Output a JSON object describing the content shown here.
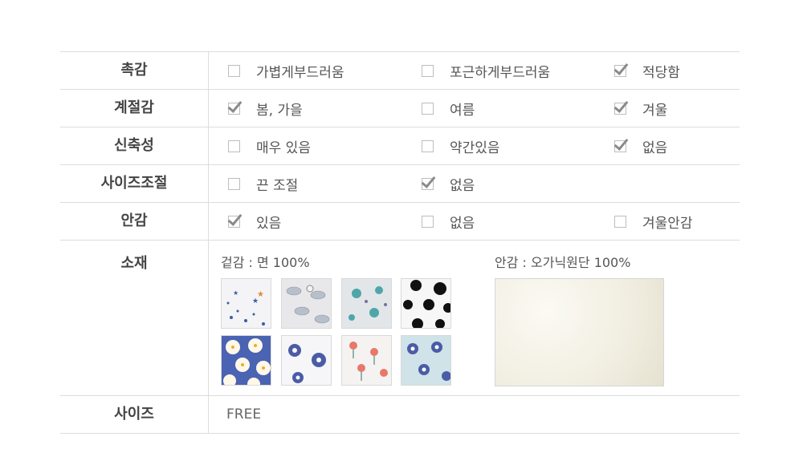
{
  "rows": [
    {
      "label": "촉감",
      "options": [
        {
          "text": "가볍게부드러움",
          "checked": false
        },
        {
          "text": "포근하게부드러움",
          "checked": false
        },
        {
          "text": "적당함",
          "checked": true
        }
      ]
    },
    {
      "label": "계절감",
      "options": [
        {
          "text": "봄, 가을",
          "checked": true
        },
        {
          "text": "여름",
          "checked": false
        },
        {
          "text": "겨울",
          "checked": true
        }
      ]
    },
    {
      "label": "신축성",
      "options": [
        {
          "text": "매우 있음",
          "checked": false
        },
        {
          "text": "약간있음",
          "checked": false
        },
        {
          "text": "없음",
          "checked": true
        }
      ]
    },
    {
      "label": "사이즈조절",
      "options": [
        {
          "text": "끈 조절",
          "checked": false
        },
        {
          "text": "없음",
          "checked": true
        }
      ]
    },
    {
      "label": "안감",
      "options": [
        {
          "text": "있음",
          "checked": true
        },
        {
          "text": "없음",
          "checked": false
        },
        {
          "text": "겨울안감",
          "checked": false
        }
      ]
    }
  ],
  "material": {
    "label": "소재",
    "outer": "겉감 : 면 100%",
    "lining": "안감 : 오가닉원단 100%",
    "swatches": [
      "star-pattern",
      "leaf-pattern",
      "teal-floral-pattern",
      "polka-dot-pattern",
      "blue-daisy-pattern",
      "white-daisy-pattern",
      "red-flower-pattern",
      "mint-daisy-pattern"
    ]
  },
  "size": {
    "label": "사이즈",
    "value": "FREE"
  }
}
